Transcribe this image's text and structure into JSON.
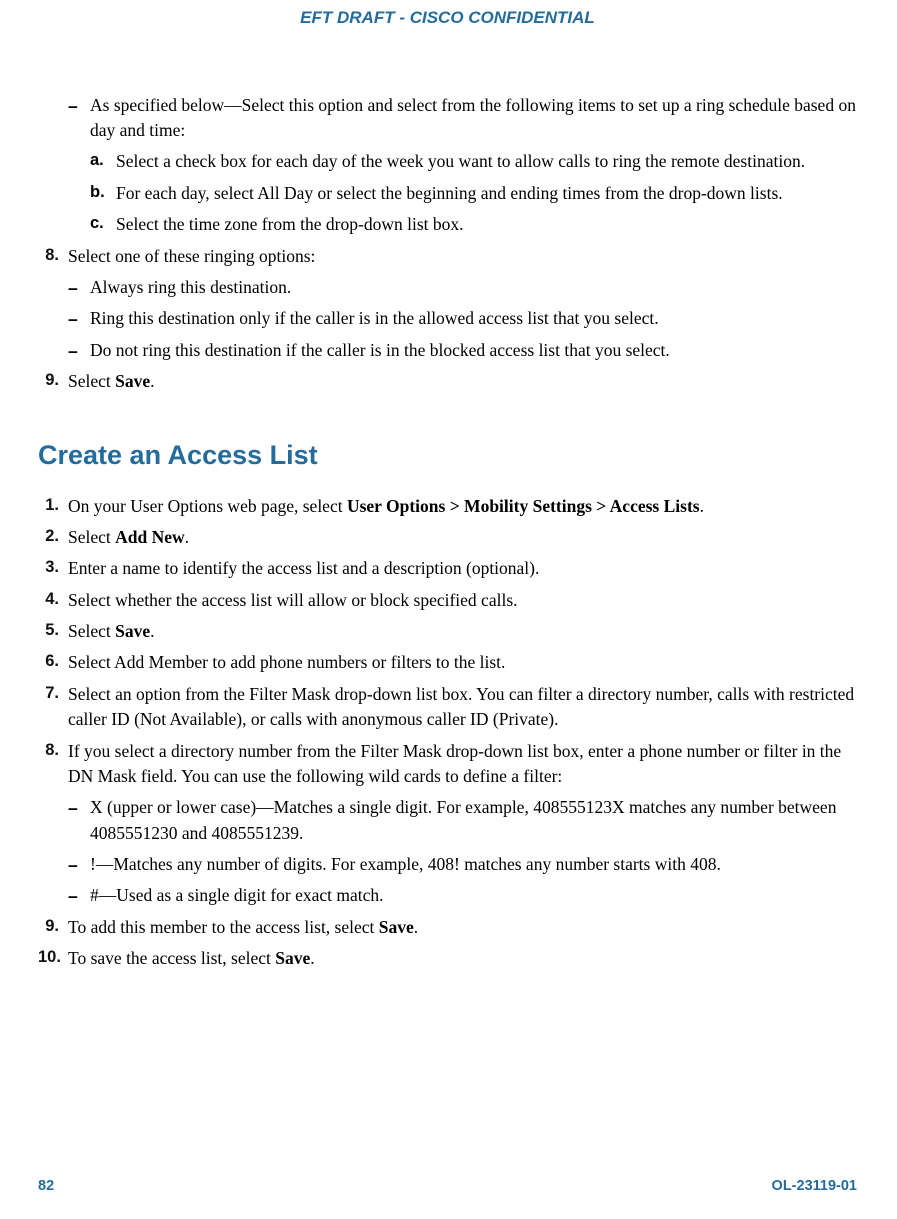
{
  "header": "EFT DRAFT - CISCO CONFIDENTIAL",
  "top": {
    "dash_intro": "As specified below—Select this option and select from the following items to set up a ring schedule based on day and time:",
    "a": "Select a check box for each day of the week you want to allow calls to ring the remote destination.",
    "b": "For each day, select All Day or select the beginning and ending times from the drop-down lists.",
    "c": "Select the time zone from the drop-down list box.",
    "s8_label": "8.",
    "s8_text": "Select one of these ringing options:",
    "s8_d1": "Always ring this destination.",
    "s8_d2": "Ring this destination only if the caller is in the allowed access list that you select.",
    "s8_d3": "Do not ring this destination if the caller is in the blocked access list that you select.",
    "s9_label": "9.",
    "s9_pre": "Select ",
    "s9_bold": "Save",
    "s9_post": "."
  },
  "section_title": "Create an Access List",
  "steps": {
    "n1": "1.",
    "t1a": "On your User Options web page, select ",
    "t1b": "User Options > Mobility Settings > Access Lists",
    "t1c": ".",
    "n2": "2.",
    "t2a": "Select ",
    "t2b": "Add New",
    "t2c": ".",
    "n3": "3.",
    "t3": "Enter a name to identify the access list and a description (optional).",
    "n4": "4.",
    "t4": "Select whether the access list will allow or block specified calls.",
    "n5": "5.",
    "t5a": "Select ",
    "t5b": "Save",
    "t5c": ".",
    "n6": "6.",
    "t6": "Select Add Member to add phone numbers or filters to the list.",
    "n7": "7.",
    "t7": "Select an option from the Filter Mask drop-down list box. You can filter a directory number, calls with restricted caller ID (Not Available), or calls with anonymous caller ID (Private).",
    "n8": "8.",
    "t8": "If you select a directory number from the Filter Mask drop-down list box, enter a phone number or filter in the DN Mask field. You can use the following wild cards to define a filter:",
    "d8a": "X (upper or lower case)—Matches a single digit. For example, 408555123X matches any number between 4085551230 and 4085551239.",
    "d8b": "!—Matches any number of digits. For example, 408! matches any number starts with 408.",
    "d8c": "#—Used as a single digit for exact match.",
    "n9": "9.",
    "t9a": "To add this member to the access list, select ",
    "t9b": "Save",
    "t9c": ".",
    "n10": "10.",
    "t10a": "To save the access list, select ",
    "t10b": "Save",
    "t10c": "."
  },
  "footer": {
    "page": "82",
    "docid": "OL-23119-01"
  }
}
